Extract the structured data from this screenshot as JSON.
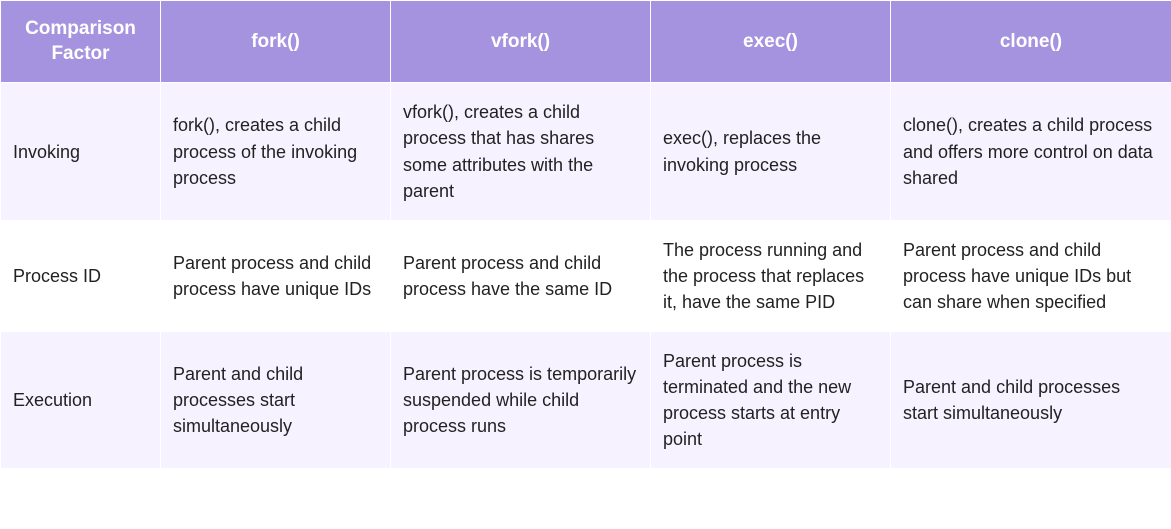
{
  "headers": {
    "factor": "Comparison Factor",
    "fork": "fork()",
    "vfork": "vfork()",
    "exec": "exec()",
    "clone": "clone()"
  },
  "rows": [
    {
      "factor": "Invoking",
      "fork": "fork(), creates a child process of the invoking process",
      "vfork": "vfork(), creates a child process that has shares some attributes with the parent",
      "exec": "exec(), replaces the invoking process",
      "clone": "clone(), creates a child process and offers more control on data shared"
    },
    {
      "factor": "Process ID",
      "fork": "Parent process and child process have unique IDs",
      "vfork": "Parent process and child process have the same ID",
      "exec": "The process running and the process that replaces it, have the same PID",
      "clone": "Parent process and child process have unique IDs but can share when specified"
    },
    {
      "factor": "Execution",
      "fork": "Parent and child processes start simultaneously",
      "vfork": "Parent process is temporarily suspended while child process runs",
      "exec": "Parent process is terminated and the new process starts at entry point",
      "clone": "Parent and child processes start simultaneously"
    }
  ]
}
